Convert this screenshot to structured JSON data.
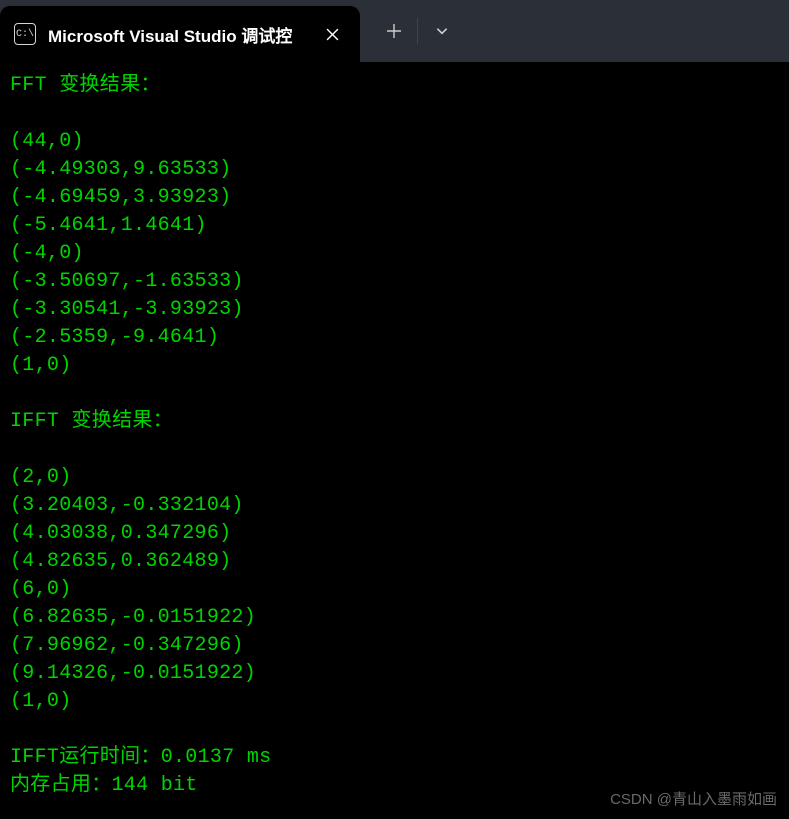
{
  "window": {
    "tab_title": "Microsoft Visual Studio 调试控",
    "tab_icon_label": "C:\\"
  },
  "terminal": {
    "lines": [
      "FFT 变换结果：",
      "",
      "(44,0)",
      "(-4.49303,9.63533)",
      "(-4.69459,3.93923)",
      "(-5.4641,1.4641)",
      "(-4,0)",
      "(-3.50697,-1.63533)",
      "(-3.30541,-3.93923)",
      "(-2.5359,-9.4641)",
      "(1,0)",
      "",
      "IFFT 变换结果：",
      "",
      "(2,0)",
      "(3.20403,-0.332104)",
      "(4.03038,0.347296)",
      "(4.82635,0.362489)",
      "(6,0)",
      "(6.82635,-0.0151922)",
      "(7.96962,-0.347296)",
      "(9.14326,-0.0151922)",
      "(1,0)",
      "",
      "IFFT运行时间：0.0137 ms",
      "内存占用：144 bit"
    ]
  },
  "watermark": "CSDN @青山入墨雨如画"
}
